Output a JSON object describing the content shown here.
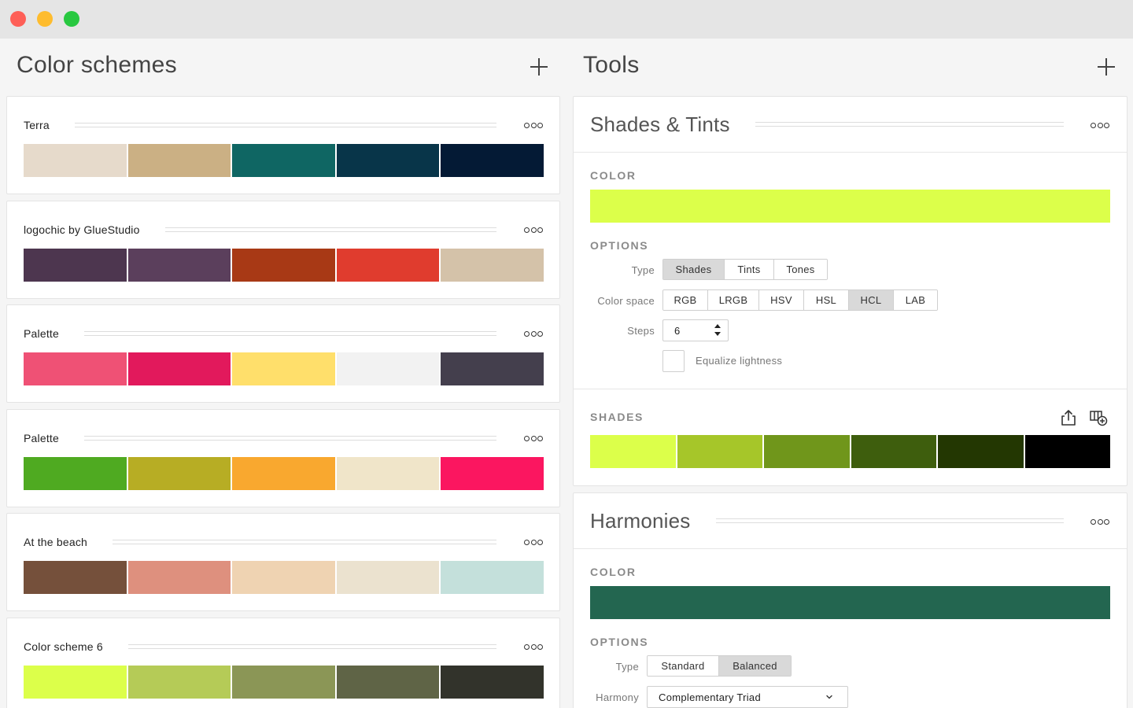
{
  "window": {
    "close": "#fe5f57",
    "minimize": "#febc2e",
    "zoom": "#28c840"
  },
  "left_panel": {
    "title": "Color schemes",
    "schemes": [
      {
        "name": "Terra",
        "colors": [
          "#e6dacb",
          "#cbb084",
          "#0f6663",
          "#083549",
          "#041a35"
        ]
      },
      {
        "name": "logochic by GlueStudio",
        "colors": [
          "#4d364f",
          "#5b3f5c",
          "#a83915",
          "#e03c2e",
          "#d4c2a9"
        ]
      },
      {
        "name": "Palette",
        "colors": [
          "#ef5175",
          "#e2195c",
          "#ffdf6b",
          "#f2f2f2",
          "#443f4d"
        ]
      },
      {
        "name": "Palette",
        "colors": [
          "#4faa21",
          "#b7ad24",
          "#f9a82f",
          "#f0e5c9",
          "#fb1660"
        ]
      },
      {
        "name": "At the beach",
        "colors": [
          "#75503b",
          "#de907e",
          "#efd3b2",
          "#ebe2cf",
          "#c4e0db"
        ]
      },
      {
        "name": "Color scheme 6",
        "colors": [
          "#dcff4a",
          "#b5cb57",
          "#8b9656",
          "#5f6446",
          "#32332b"
        ]
      }
    ]
  },
  "right_panel": {
    "title": "Tools",
    "shades_tints": {
      "title": "Shades & Tints",
      "color_label": "COLOR",
      "color": "#dcff4a",
      "options_label": "OPTIONS",
      "type_label": "Type",
      "type_options": [
        "Shades",
        "Tints",
        "Tones"
      ],
      "type_selected": "Shades",
      "space_label": "Color space",
      "space_options": [
        "RGB",
        "LRGB",
        "HSV",
        "HSL",
        "HCL",
        "LAB"
      ],
      "space_selected": "HCL",
      "steps_label": "Steps",
      "steps_value": "6",
      "equalize_label": "Equalize lightness",
      "equalize_checked": false,
      "shades_label": "SHADES",
      "shades": [
        "#dcff4a",
        "#a6c629",
        "#70961b",
        "#3e5e0d",
        "#233702",
        "#000000"
      ],
      "export_icon": "share-icon",
      "add_icon": "add-scheme-icon"
    },
    "harmonies": {
      "title": "Harmonies",
      "color_label": "COLOR",
      "color": "#236650",
      "options_label": "OPTIONS",
      "type_label": "Type",
      "type_options": [
        "Standard",
        "Balanced"
      ],
      "type_selected": "Balanced",
      "harmony_label": "Harmony",
      "harmony_value": "Complementary Triad"
    }
  }
}
